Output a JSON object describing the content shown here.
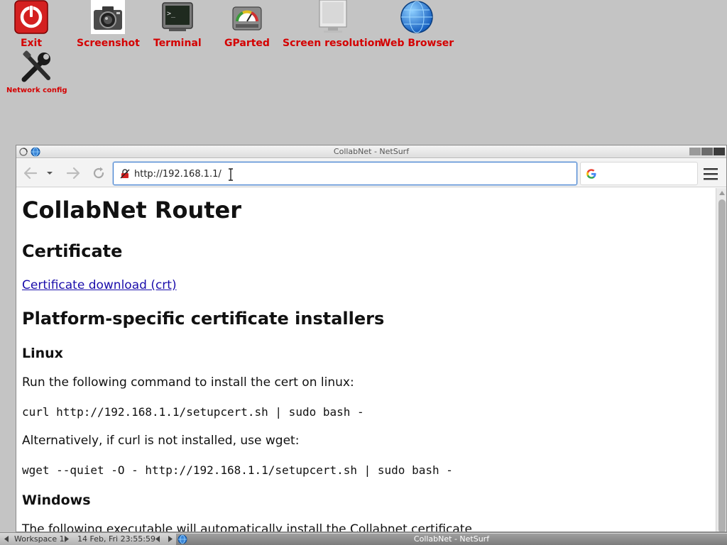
{
  "desktop": {
    "icons": [
      {
        "label": "Exit",
        "icon": "power-icon"
      },
      {
        "label": "Screenshot",
        "icon": "camera-icon"
      },
      {
        "label": "Terminal",
        "icon": "terminal-icon"
      },
      {
        "label": "GParted",
        "icon": "disk-gauge-icon"
      },
      {
        "label": "Screen resolution",
        "icon": "monitor-icon"
      },
      {
        "label": "Web Browser",
        "icon": "globe-icon"
      },
      {
        "label": "Network config",
        "icon": "tools-icon"
      }
    ],
    "label_color": "#d40000",
    "background_color": "#c4c4c4"
  },
  "window": {
    "title": "CollabNet - NetSurf",
    "url": "http://192.168.1.1/",
    "search_placeholder": "",
    "search_engine_icon": "google-icon"
  },
  "page": {
    "h1": "CollabNet Router",
    "cert_heading": "Certificate",
    "cert_link": "Certificate download (crt)",
    "installers_heading": "Platform-specific certificate installers",
    "linux_heading": "Linux",
    "linux_text": "Run the following command to install the cert on linux:",
    "linux_cmd1": "curl http://192.168.1.1/setupcert.sh | sudo bash -",
    "linux_alt_text": "Alternatively, if curl is not installed, use wget:",
    "linux_cmd2": "wget --quiet -O - http://192.168.1.1/setupcert.sh | sudo bash -",
    "windows_heading": "Windows",
    "windows_text": "The following executable will automatically install the Collabnet certificate"
  },
  "taskbar": {
    "workspace": "Workspace 1",
    "datetime": "14 Feb, Fri 23:55:59",
    "task_title": "CollabNet - NetSurf"
  }
}
